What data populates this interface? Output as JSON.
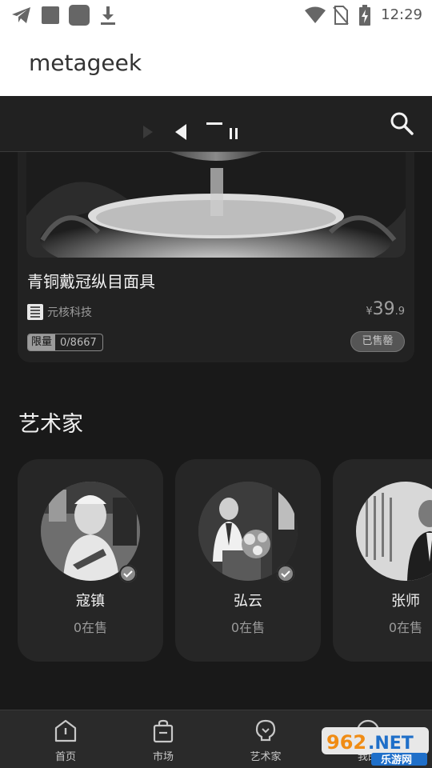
{
  "status_bar": {
    "time": "12:29",
    "icons": [
      "telegram-icon",
      "square-icon",
      "rounded-square-icon",
      "download-icon",
      "wifi-icon",
      "no-sim-icon",
      "battery-icon"
    ]
  },
  "app": {
    "title": "metageek"
  },
  "top_nav": {
    "icons": [
      "play-icon",
      "previous-icon",
      "dash-icon",
      "pause-icon",
      "search-icon"
    ]
  },
  "product": {
    "title": "青铜戴冠纵目面具",
    "brand": "元核科技",
    "price_symbol": "¥",
    "price_int": "39",
    "price_dec": ".9",
    "limit_label": "限量",
    "limit_count": "0/8667",
    "status_label": "已售罄"
  },
  "artists_section": {
    "title": "艺术家",
    "artists": [
      {
        "name": "寇镇",
        "sales": "0在售",
        "verified": true
      },
      {
        "name": "弘云",
        "sales": "0在售",
        "verified": true
      },
      {
        "name": "张师",
        "sales": "0在售",
        "verified": false
      }
    ]
  },
  "bottom_nav": {
    "tabs": [
      {
        "label": "首页",
        "icon": "home-icon"
      },
      {
        "label": "市场",
        "icon": "shopping-bag-icon"
      },
      {
        "label": "艺术家",
        "icon": "lightbulb-icon"
      },
      {
        "label": "我的",
        "icon": "user-icon"
      }
    ]
  },
  "watermark": {
    "logo": "962.NET",
    "text": "乐游网"
  },
  "colors": {
    "background": "#191919",
    "card": "#222222",
    "accent_text": "#f0f0f0"
  }
}
